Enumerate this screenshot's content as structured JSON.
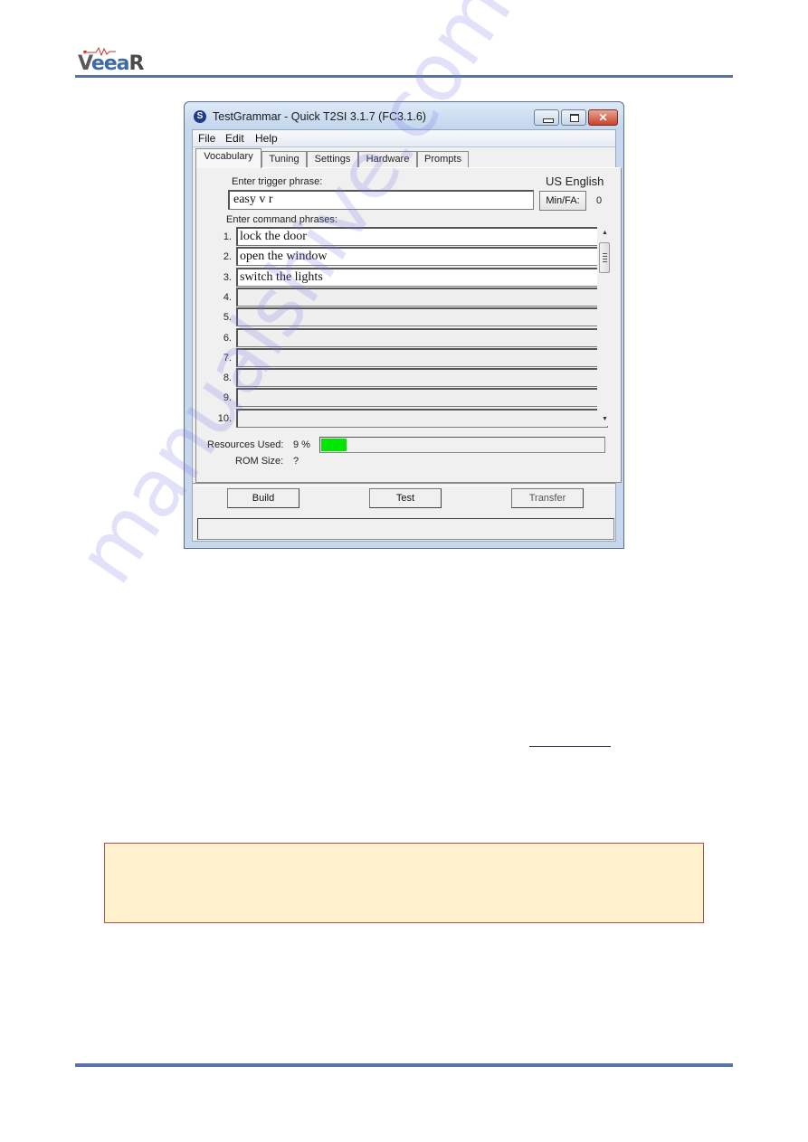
{
  "brand": {
    "logo_text_v": "V",
    "logo_text_ee": "eea",
    "logo_text_r": "R",
    "rule_color": "#5a74a8"
  },
  "window": {
    "title": "TestGrammar - Quick T2SI 3.1.7 (FC3.1.6)",
    "app_icon": "S",
    "close_glyph": "✕",
    "menu": [
      "File",
      "Edit",
      "Help"
    ],
    "tabs": [
      {
        "label": "Vocabulary",
        "active": true
      },
      {
        "label": "Tuning",
        "active": false
      },
      {
        "label": "Settings",
        "active": false
      },
      {
        "label": "Hardware",
        "active": false
      },
      {
        "label": "Prompts",
        "active": false
      }
    ],
    "vocabulary": {
      "trigger_label": "Enter trigger phrase:",
      "trigger_value": "easy v r",
      "language": "US English",
      "minfa_button": "Min/FA:",
      "minfa_value": "0",
      "commands_label": "Enter command phrases:",
      "commands": [
        {
          "num": "1.",
          "value": "lock the door"
        },
        {
          "num": "2.",
          "value": "open the window"
        },
        {
          "num": "3.",
          "value": "switch the lights"
        },
        {
          "num": "4.",
          "value": ""
        },
        {
          "num": "5.",
          "value": ""
        },
        {
          "num": "6.",
          "value": ""
        },
        {
          "num": "7.",
          "value": ""
        },
        {
          "num": "8.",
          "value": ""
        },
        {
          "num": "9.",
          "value": ""
        },
        {
          "num": "10.",
          "value": ""
        }
      ],
      "scroll_up": "▲",
      "scroll_down": "▼",
      "resources_label": "Resources Used:",
      "resources_value": "9 %",
      "resources_fraction": 0.09,
      "resources_color": "#00e600",
      "rom_label": "ROM Size:",
      "rom_value": "?"
    },
    "buttons": {
      "build": "Build",
      "test": "Test",
      "transfer": "Transfer"
    },
    "status_text": ""
  },
  "note_box": {
    "background": "#fff2cc",
    "border": "#b5504a"
  },
  "watermark": "manualshive.com"
}
